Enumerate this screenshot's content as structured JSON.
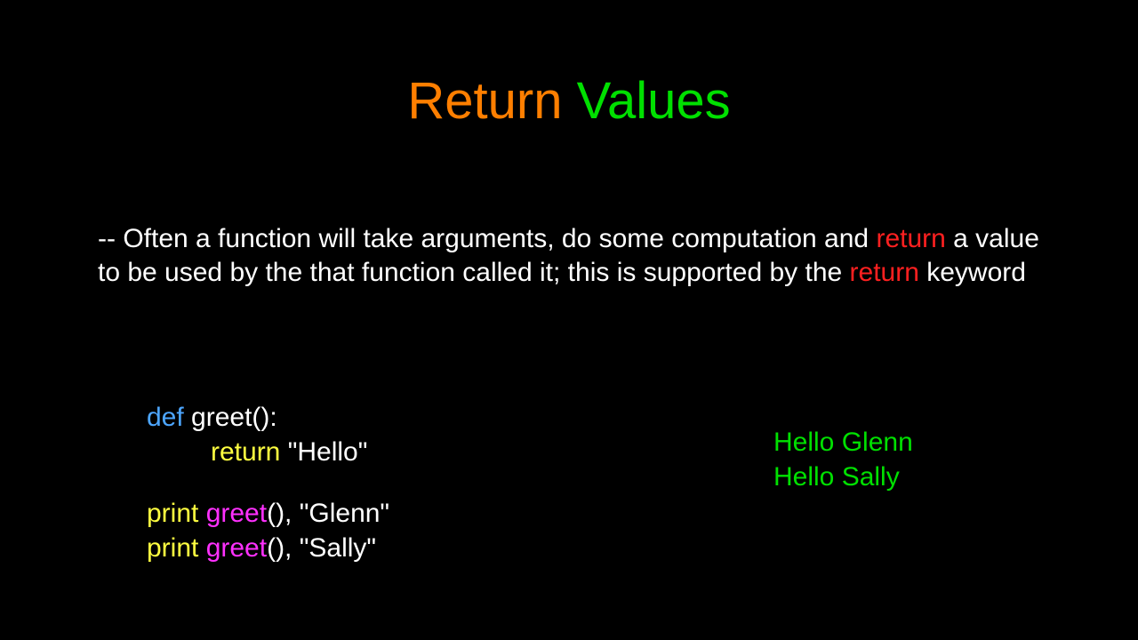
{
  "title": {
    "word1": "Return",
    "word2": "Values"
  },
  "body": {
    "pre1": "-- Often a function will take arguments, do some computation and ",
    "hl1": "return",
    "mid1": " a value to be used by the that function called it; this is supported by the ",
    "hl2": "return",
    "post1": " keyword"
  },
  "code": {
    "line1": {
      "kw": "def",
      "rest": " greet():"
    },
    "line2": {
      "kw": "return",
      "rest": " \"Hello\""
    },
    "line3": {
      "kw": "print",
      "fn": " greet",
      "rest": "(), \"Glenn\""
    },
    "line4": {
      "kw": "print",
      "fn": " greet",
      "rest": "(), \"Sally\""
    }
  },
  "output": {
    "line1": "Hello Glenn",
    "line2": "Hello Sally"
  }
}
